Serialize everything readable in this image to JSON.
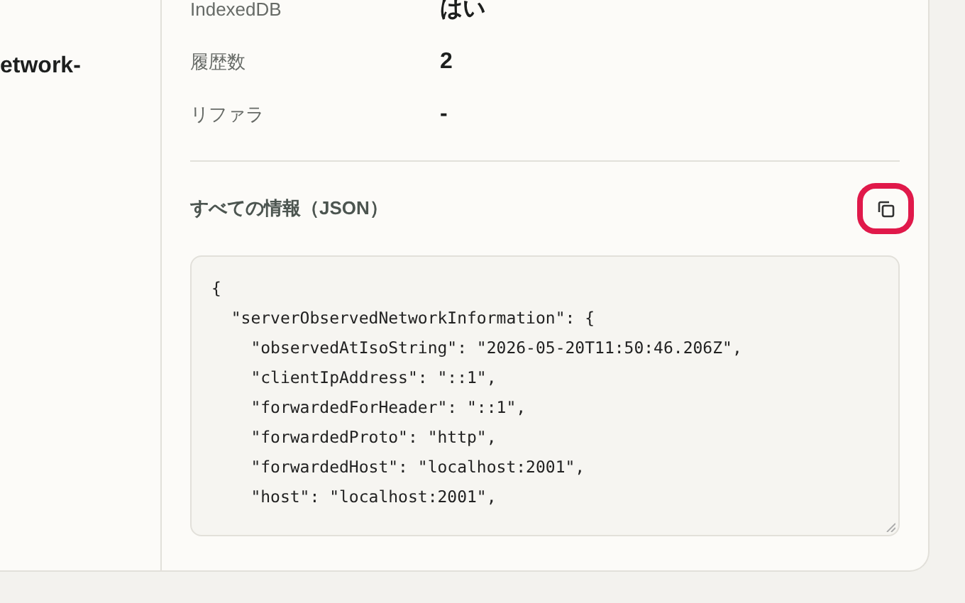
{
  "sidebar": {
    "title_fragment": "etwork-"
  },
  "info_rows": [
    {
      "label": "IndexedDB",
      "value": "はい"
    },
    {
      "label": "履歴数",
      "value": "2"
    },
    {
      "label": "リファラ",
      "value": "-"
    }
  ],
  "json_section": {
    "heading": "すべての情報（JSON）",
    "lines": [
      "{",
      "  \"serverObservedNetworkInformation\": {",
      "    \"observedAtIsoString\": \"2026-05-20T11:50:46.206Z\",",
      "    \"clientIpAddress\": \"::1\",",
      "    \"forwardedForHeader\": \"::1\",",
      "    \"forwardedProto\": \"http\",",
      "    \"forwardedHost\": \"localhost:2001\",",
      "    \"host\": \"localhost:2001\","
    ]
  }
}
